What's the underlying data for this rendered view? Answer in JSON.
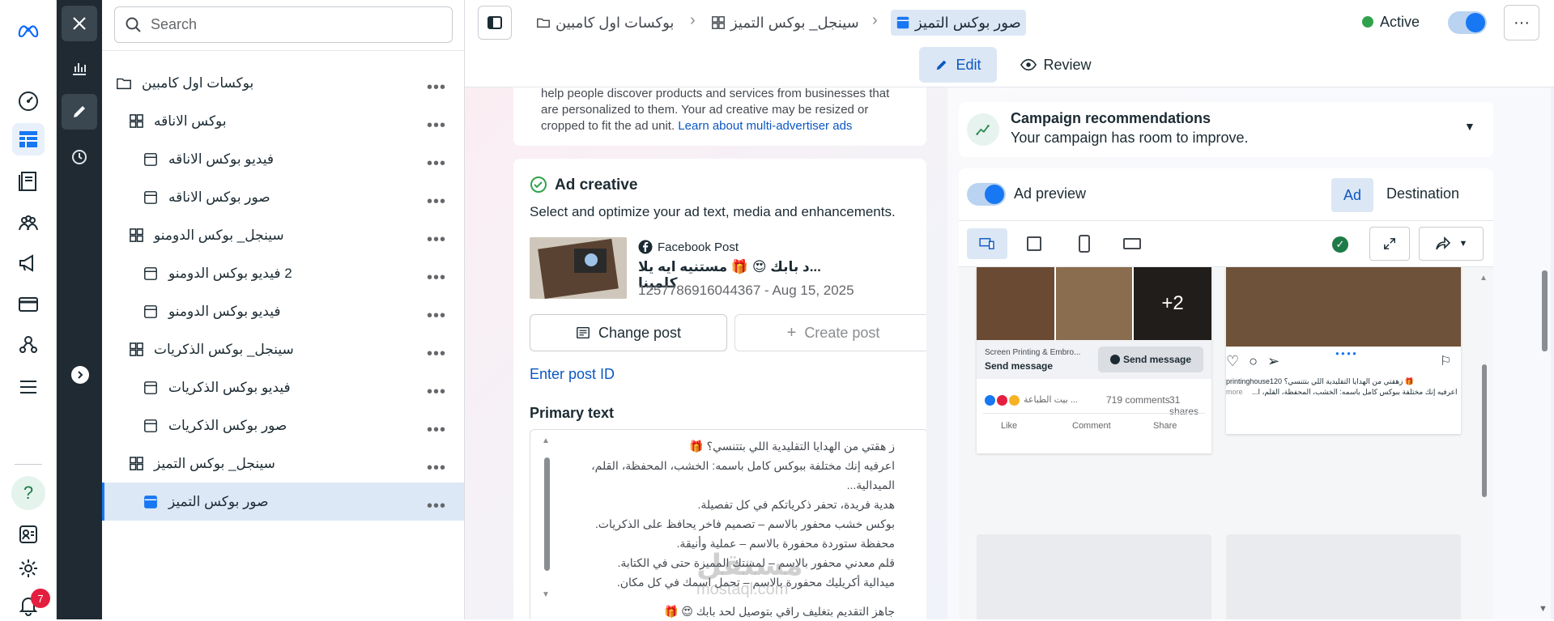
{
  "rail": {
    "help": "?",
    "notifications_count": "7"
  },
  "search": {
    "placeholder": "Search"
  },
  "tree": [
    {
      "label": "بوكسات اول كامبين",
      "type": "campaign",
      "indent": 0
    },
    {
      "label": "بوكس الاناقه",
      "type": "adset",
      "indent": 1
    },
    {
      "label": "فيديو بوكس الاناقه",
      "type": "ad",
      "indent": 2
    },
    {
      "label": "صور بوكس الاناقه",
      "type": "ad",
      "indent": 2
    },
    {
      "label": "سينجل_ بوكس الدومنو",
      "type": "adset",
      "indent": 1
    },
    {
      "label": "2 فيديو بوكس الدومنو",
      "type": "ad",
      "indent": 2
    },
    {
      "label": "فيديو بوكس الدومنو",
      "type": "ad",
      "indent": 2
    },
    {
      "label": "سينجل_ بوكس الذكريات",
      "type": "adset",
      "indent": 1
    },
    {
      "label": "فيديو بوكس الذكريات",
      "type": "ad",
      "indent": 2
    },
    {
      "label": "صور بوكس الذكريات",
      "type": "ad",
      "indent": 2
    },
    {
      "label": "سينجل_ بوكس التميز",
      "type": "adset",
      "indent": 1
    },
    {
      "label": "صور بوكس التميز",
      "type": "ad",
      "indent": 2,
      "selected": true
    }
  ],
  "breadcrumb": {
    "campaign": "بوكسات اول كامبين",
    "adset": "سينجل_ بوكس التميز",
    "ad": "صور بوكس التميز"
  },
  "status": {
    "label": "Active",
    "color": "#31a24c"
  },
  "tabs": {
    "edit": "Edit",
    "review": "Review"
  },
  "placement_text": {
    "line1": "help people discover products and services from businesses that",
    "line2": "are personalized to them. Your ad creative may be resized or",
    "line3": "cropped to fit the ad unit.",
    "link": "Learn about multi-advertiser ads"
  },
  "creative": {
    "title": "Ad creative",
    "desc": "Select and optimize your ad text, media and enhancements.",
    "source": "Facebook Post",
    "post_title": "...د بابك 😍 🎁 مستنيه ايه يلا كلمينا",
    "post_id": "1257786916044367 - Aug 15, 2025",
    "change_post": "Change post",
    "create_post": "Create post",
    "enter_post_id": "Enter post ID",
    "primary_text_label": "Primary text",
    "primary_text_lines": [
      "ز هقتي من الهدايا التقليدية اللي بتتنسي؟ 🎁",
      "اعرفيه إنك مختلفة ببوكس كامل باسمه: الخشب، المحفظة، القلم، الميدالية...",
      "هدية فريدة، تحفر ذكرياتكم في كل تفصيلة.",
      "بوكس خشب محفور بالاسم – تصميم فاخر يحافظ على الذكريات.",
      "محفظة ستوردة محفورة بالاسم – عملية وأنيقة.",
      "قلم معدني محفور بالاسم – لمستك المميزة حتى في الكتابة.",
      "ميدالية أكريليك محفورة بالاسم – تحمل اسمك في كل مكان.",
      "جاهز التقديم بتغليف راقي بتوصيل لحد بابك 😍 🎁"
    ]
  },
  "recommendations": {
    "title": "Campaign recommendations",
    "subtitle": "Your campaign has room to improve."
  },
  "preview": {
    "label": "Ad preview",
    "tab_ad": "Ad",
    "tab_destination": "Destination",
    "fb_more": "+2",
    "fb_page": "Screen Printing & Embro...",
    "fb_cta_left": "Send message",
    "fb_cta_btn": "Send message",
    "fb_reactions": "... بيت الطباعة",
    "fb_comments": "719 comments",
    "fb_shares": "31 shares",
    "fb_like": "Like",
    "fb_comment": "Comment",
    "fb_share": "Share",
    "ig_caption": "printinghouse120 زهقتي من الهدايا التقليدية اللي بتتنسي؟ 🎁",
    "ig_caption2": "اعرفيه إنك مختلفة ببوكس كامل باسمه: الخشب، المحفظة، القلم، ا...",
    "ig_more": "more"
  },
  "watermark": {
    "arabic": "مستقل",
    "latin": "mostaql.com"
  },
  "colors": {
    "accent": "#1877f2",
    "dark_strip": "#1f2a33",
    "selection": "#dde8f6"
  }
}
